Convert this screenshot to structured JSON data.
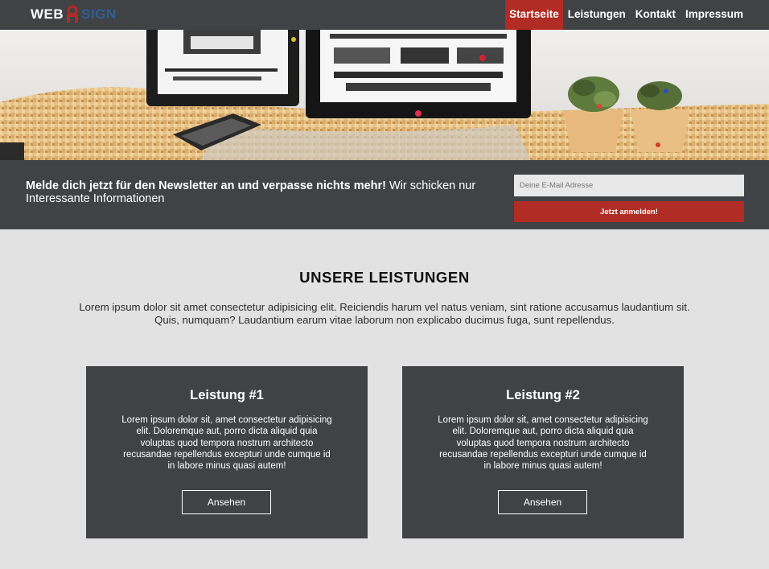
{
  "header": {
    "logo": {
      "part1": "WEB",
      "part2": "SIGN"
    },
    "nav": [
      {
        "label": "Startseite",
        "active": true
      },
      {
        "label": "Leistungen",
        "active": false
      },
      {
        "label": "Kontakt",
        "active": false
      },
      {
        "label": "Impressum",
        "active": false
      }
    ]
  },
  "newsletter": {
    "headline": "Melde dich jetzt für den Newsletter an und verpasse nichts mehr!",
    "text": " Wir schicken nur Interessante Informationen",
    "email_placeholder": "Deine E-Mail Adresse",
    "button_label": "Jetzt anmelden!"
  },
  "services": {
    "title": "UNSERE LEISTUNGEN",
    "intro": "Lorem ipsum dolor sit amet consectetur adipisicing elit. Reiciendis harum vel natus veniam, sint ratione accusamus laudantium sit. Quis, numquam? Laudantium earum vitae laborum non explicabo ducimus fuga, sunt repellendus.",
    "cards": [
      {
        "title": "Leistung #1",
        "text": "Lorem ipsum dolor sit, amet consectetur adipisicing elit. Doloremque aut, porro dicta aliquid quia voluptas quod tempora nostrum architecto recusandae repellendus excepturi unde cumque id in labore minus quasi autem!",
        "button": "Ansehen"
      },
      {
        "title": "Leistung #2",
        "text": "Lorem ipsum dolor sit, amet consectetur adipisicing elit. Doloremque aut, porro dicta aliquid quia voluptas quod tempora nostrum architecto recusandae repellendus excepturi unde cumque id in labore minus quasi autem!",
        "button": "Ansehen"
      }
    ]
  },
  "colors": {
    "dark": "#404246",
    "accent": "#b02c24",
    "background": "#e2e2e2",
    "logo_blue": "#2f5e95"
  }
}
